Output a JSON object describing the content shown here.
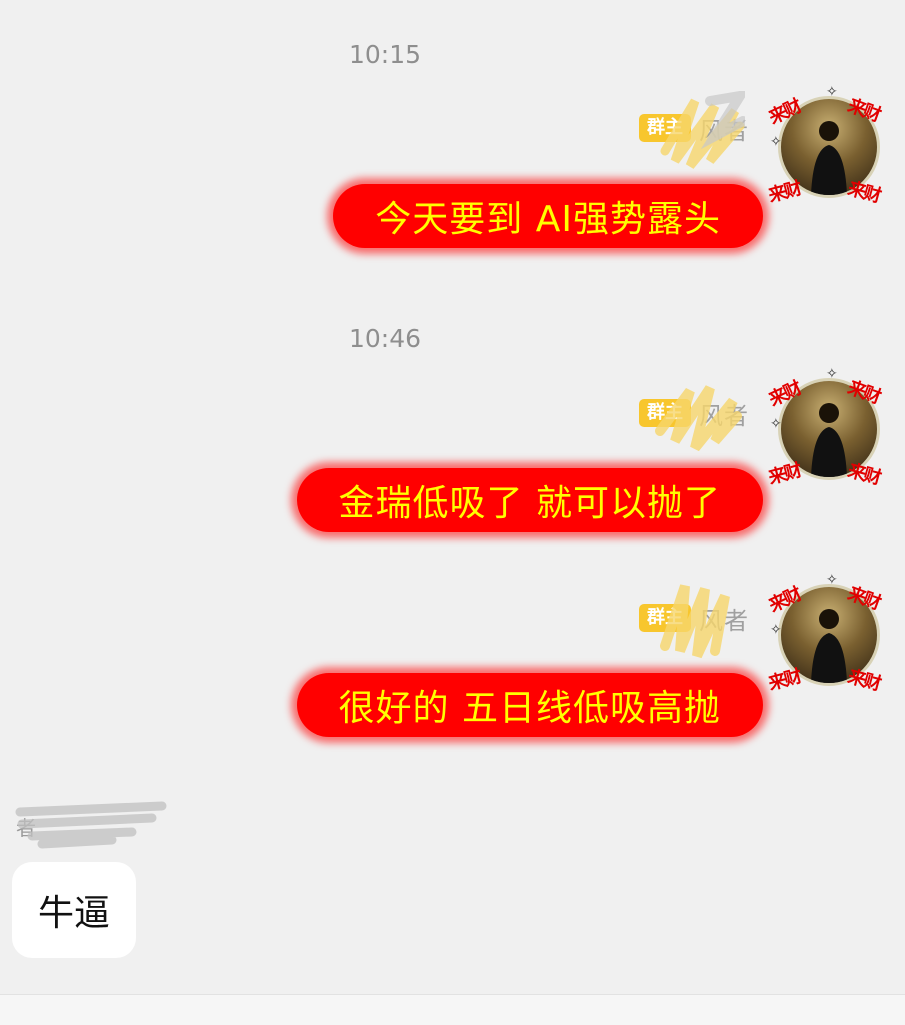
{
  "chat": {
    "messages": [
      {
        "time": "10:15",
        "badge": "群主",
        "sender": "风者",
        "text": "今天要到 AI强势露头"
      },
      {
        "time": "10:46",
        "badge": "群主",
        "sender": "风者",
        "text": "金瑞低吸了 就可以抛了"
      },
      {
        "badge": "群主",
        "sender": "风者",
        "text": "很好的 五日线低吸高抛"
      }
    ],
    "reply": {
      "sender": "者",
      "text": "牛逼"
    }
  },
  "avatar": {
    "tag": "来财",
    "sparkle": "✧"
  },
  "colors": {
    "bubble_red": "#ff0000",
    "bubble_text_yellow": "#ffff00",
    "badge": "#f8c62d"
  }
}
